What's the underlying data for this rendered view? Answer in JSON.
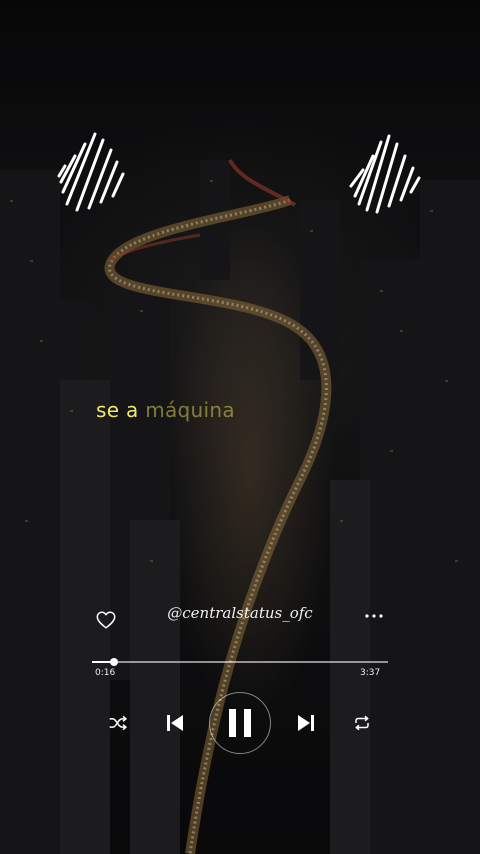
{
  "lyric": {
    "sung": "se a",
    "upcoming": "máquina"
  },
  "track": {
    "handle": "@centralstatus_ofc",
    "elapsed": "0:16",
    "total": "3:37",
    "progress": 0.0737
  },
  "icons": {
    "wave_left": "sound-wave-icon",
    "wave_right": "sound-wave-icon",
    "heart": "heart-icon",
    "more": "more-icon",
    "shuffle": "shuffle-icon",
    "prev": "skip-previous-icon",
    "pause": "pause-icon",
    "next": "skip-next-icon",
    "repeat": "repeat-icon"
  },
  "colors": {
    "lyric_sung": "#f2e86a",
    "lyric_upcoming": "#a89e46",
    "controls": "#ffffff"
  }
}
